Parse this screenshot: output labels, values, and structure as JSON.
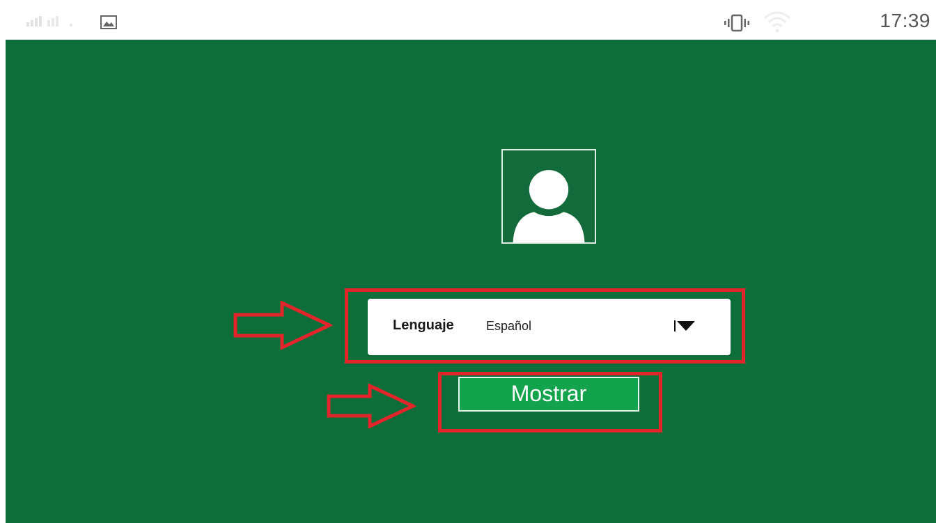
{
  "status_bar": {
    "time": "17:39",
    "icons": [
      "signal-icon",
      "image-icon",
      "vibrate-icon",
      "wifi-icon"
    ]
  },
  "login": {
    "avatar_icon": "user-avatar-icon",
    "language": {
      "label": "Lenguaje",
      "selected": "Español",
      "dropdown_icon": "triangle-down-icon"
    },
    "show_button_label": "Mostrar"
  },
  "colors": {
    "background": "#0e6e3a",
    "button": "#13a34c",
    "highlight": "#e3252b"
  }
}
